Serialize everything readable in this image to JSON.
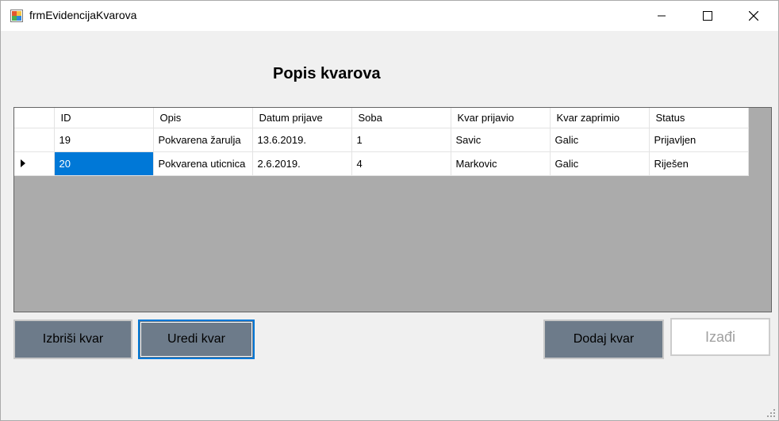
{
  "window": {
    "title": "frmEvidencijaKvarova"
  },
  "page": {
    "heading": "Popis kvarova"
  },
  "grid": {
    "columns": [
      "ID",
      "Opis",
      "Datum prijave",
      "Soba",
      "Kvar prijavio",
      "Kvar zaprimio",
      "Status"
    ],
    "rows": [
      [
        "19",
        "Pokvarena žarulja",
        "13.6.2019.",
        "1",
        "Savic",
        "Galic",
        "Prijavljen"
      ],
      [
        "20",
        "Pokvarena uticnica",
        "2.6.2019.",
        "4",
        "Markovic",
        "Galic",
        "Riješen"
      ]
    ],
    "current_row": 1,
    "selected_cell": "20"
  },
  "buttons": {
    "delete": "Izbriši kvar",
    "edit": "Uredi kvar",
    "add": "Dodaj kvar",
    "exit": "Izađi"
  },
  "colors": {
    "button_dark": "#6d7b8a",
    "selection": "#0078d7",
    "grid_background": "#ababab"
  }
}
